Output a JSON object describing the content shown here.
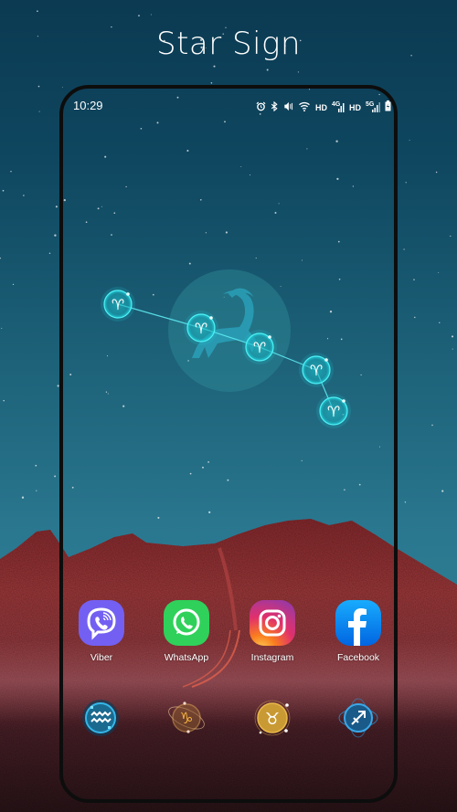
{
  "header": {
    "title": "Star Sign"
  },
  "status_bar": {
    "time": "10:29",
    "icons": [
      "alarm-icon",
      "bluetooth-icon",
      "vibrate-icon",
      "wifi-icon",
      "hd-label",
      "signal-4g-icon",
      "hd-label",
      "signal-5g-icon",
      "battery-charging-icon"
    ],
    "hd_label": "HD",
    "net1": "4G",
    "net2": "5G"
  },
  "wallpaper": {
    "theme": "Star Sign",
    "constellation_symbol": "♈",
    "center_figure": "ram-silhouette"
  },
  "apps": [
    {
      "label": "Viber",
      "icon": "viber-icon",
      "color": "#7360f2"
    },
    {
      "label": "WhatsApp",
      "icon": "whatsapp-icon",
      "color": "#2fd15a"
    },
    {
      "label": "Instagram",
      "icon": "instagram-icon",
      "color": "#e1306c"
    },
    {
      "label": "Facebook",
      "icon": "facebook-icon",
      "color": "#1877f2"
    }
  ],
  "dock": [
    {
      "name": "aquarius",
      "symbol": "♒",
      "color": "#2aa3d6"
    },
    {
      "name": "capricorn",
      "symbol": "♑",
      "color": "#d8a24a"
    },
    {
      "name": "taurus",
      "symbol": "♉",
      "color": "#d4a83a"
    },
    {
      "name": "sagittarius",
      "symbol": "♐",
      "color": "#2b8fd0"
    }
  ]
}
